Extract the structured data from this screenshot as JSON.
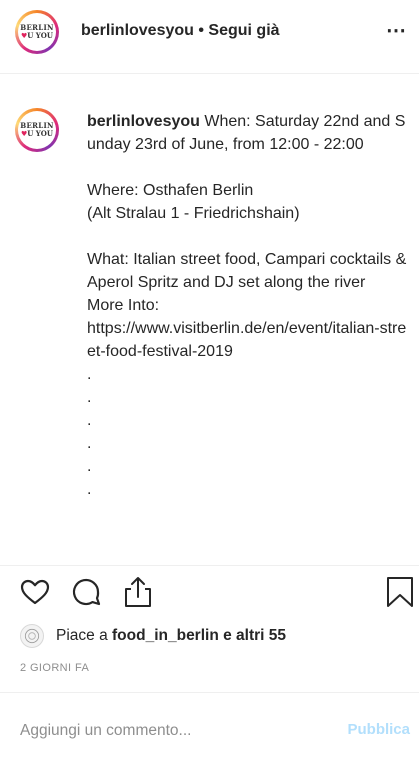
{
  "header": {
    "avatar_line1": "BERLIN",
    "avatar_heart": "♥",
    "avatar_line2": "U YOU",
    "username": "berlinlovesyou",
    "follow_text": " • Segui già",
    "more_icon": "⋯"
  },
  "post": {
    "caption_user": "berlinlovesyou",
    "caption_text": " When: Saturday 22nd and Sunday 23rd of June, from 12:00 - 22:00\n\nWhere: Osthafen Berlin\n(Alt Stralau 1 - Friedrichshain)\n\nWhat: Italian street food, Campari cocktails & Aperol Spritz and DJ set along the river\nMore Into:\nhttps://www.visitberlin.de/en/event/italian-street-food-festival-2019\n.\n.\n.\n.\n.\n.",
    "icons": [
      "heart-icon",
      "comment-icon",
      "share-icon",
      "bookmark-icon"
    ]
  },
  "likes": {
    "prefix": "Piace a ",
    "user": "food_in_berlin",
    "suffix": " e altri 55"
  },
  "timestamp": "2 GIORNI FA",
  "comment": {
    "placeholder": "Aggiungi un commento...",
    "publish_label": "Pubblica"
  }
}
